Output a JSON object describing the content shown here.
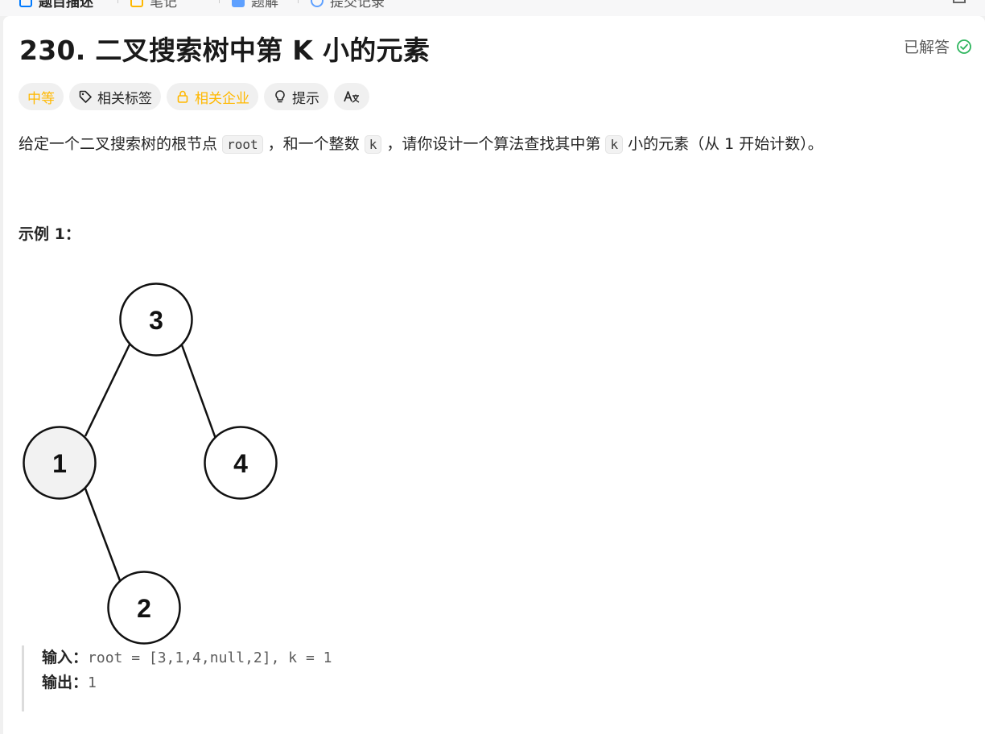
{
  "tabs": [
    {
      "label": "题目描述"
    },
    {
      "label": "笔记"
    },
    {
      "label": "题解"
    },
    {
      "label": "提交记录"
    }
  ],
  "problem": {
    "title": "230. 二叉搜索树中第 K 小的元素",
    "status": "已解答",
    "tags": {
      "difficulty": "中等",
      "related_tags": "相关标签",
      "related_companies": "相关企业",
      "hint": "提示"
    },
    "description": {
      "part1": "给定一个二叉搜索树的根节点",
      "code1": "root",
      "part2": "，和一个整数",
      "code2": "k",
      "part3": "，请你设计一个算法查找其中第",
      "code3": "k",
      "part4": "小的元素（从 1 开始计数）。"
    },
    "example": {
      "title": "示例 1：",
      "tree_nodes": {
        "root": "3",
        "left": "1",
        "right": "4",
        "left_right": "2"
      },
      "input_label": "输入：",
      "input_value": "root = [3,1,4,null,2], k = 1",
      "output_label": "输出：",
      "output_value": "1"
    }
  },
  "colors": {
    "accent_green": "#2db55d",
    "difficulty_medium": "#ffb800",
    "highlight_node": "#f2f2f2"
  }
}
